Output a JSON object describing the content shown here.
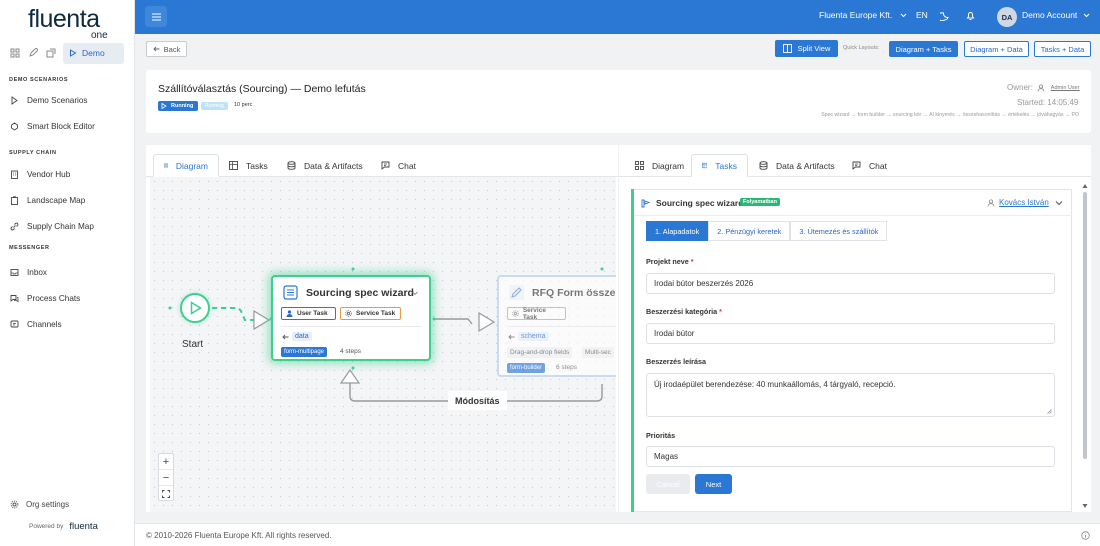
{
  "brand": {
    "logo_main": "fluenta",
    "logo_sub": "one",
    "powered_by": "Powered by",
    "powered_logo": "fluenta"
  },
  "sidebar": {
    "mode_demo": "Demo",
    "sections": [
      {
        "title": "DEMO SCENARIOS",
        "items": [
          {
            "label": "Demo Scenarios",
            "icon": "play-icon"
          },
          {
            "label": "Smart Block Editor",
            "icon": "blocks-icon"
          }
        ]
      },
      {
        "title": "SUPPLY CHAIN",
        "items": [
          {
            "label": "Vendor Hub",
            "icon": "building-icon"
          },
          {
            "label": "Landscape Map",
            "icon": "clipboard-icon"
          },
          {
            "label": "Supply Chain Map",
            "icon": "link-icon"
          }
        ]
      },
      {
        "title": "MESSENGER",
        "items": [
          {
            "label": "Inbox",
            "icon": "inbox-icon"
          },
          {
            "label": "Process Chats",
            "icon": "chats-icon"
          },
          {
            "label": "Channels",
            "icon": "channel-icon"
          }
        ]
      }
    ],
    "org_settings": "Org settings"
  },
  "topbar": {
    "company": "Fluenta Europe Kft.",
    "lang": "EN",
    "avatar": "DA",
    "account": "Demo Account"
  },
  "toolbar": {
    "back": "Back",
    "split_view": "Split View",
    "quick_layouts": "Quick Layouts:",
    "layouts": [
      "Diagram + Tasks",
      "Diagram + Data",
      "Tasks + Data"
    ],
    "active_layout": 0
  },
  "header": {
    "title": "Szállítóválasztás (Sourcing) — Demo lefutás",
    "status": "Running",
    "phase": "Running",
    "duration": "10 perc",
    "owner_label": "Owner:",
    "owner": "Admin User",
    "started": "Started: 14:05:49",
    "flow": "Spec wizard → form builder → sourcing kör → AI kinyerés → összehasonlítás → értékelés → jóváhagyás → PO"
  },
  "tabs": [
    "Diagram",
    "Tasks",
    "Data & Artifacts",
    "Chat"
  ],
  "left_panel": {
    "active_tab": 0
  },
  "right_panel": {
    "active_tab": 1
  },
  "diagram": {
    "start_label": "Start",
    "loop_label": "Módosítás",
    "node1": {
      "title": "Sourcing spec wizard",
      "chips": [
        "User Task",
        "Service Task"
      ],
      "data": "data",
      "tag": "form-multipage",
      "steps": "4 steps"
    },
    "node2": {
      "title": "RFQ Form összerakó",
      "chip": "Service Task",
      "data": "schema",
      "fields": [
        "Drag-and-drop fields",
        "Multi-sec"
      ],
      "tag": "form-builder",
      "steps": "6 steps"
    }
  },
  "task": {
    "title": "Sourcing spec wizard",
    "badge": "Folyamatban",
    "assignee": "Kovács István",
    "steps": [
      "1. Alapadatok",
      "2. Pénzügyi keretek",
      "3. Ütemezés és szállítók"
    ],
    "active_step": 0,
    "fields": {
      "name": {
        "label": "Projekt neve",
        "value": "Irodai bútor beszerzés 2026"
      },
      "category": {
        "label": "Beszerzési kategória",
        "value": "Irodai bútor"
      },
      "description": {
        "label": "Beszerzés leírása",
        "value": "Új irodaépület berendezése: 40 munkaállomás, 4 tárgyaló, recepció."
      },
      "priority": {
        "label": "Prioritás",
        "value": "Magas"
      }
    },
    "cancel": "Cancel",
    "next": "Next"
  },
  "footer": {
    "copyright": "© 2010-2026 Fluenta Europe Kft. All rights reserved."
  },
  "colors": {
    "primary": "#2a78d4",
    "success": "#3ccf8e",
    "badge_green": "#2bb673"
  }
}
